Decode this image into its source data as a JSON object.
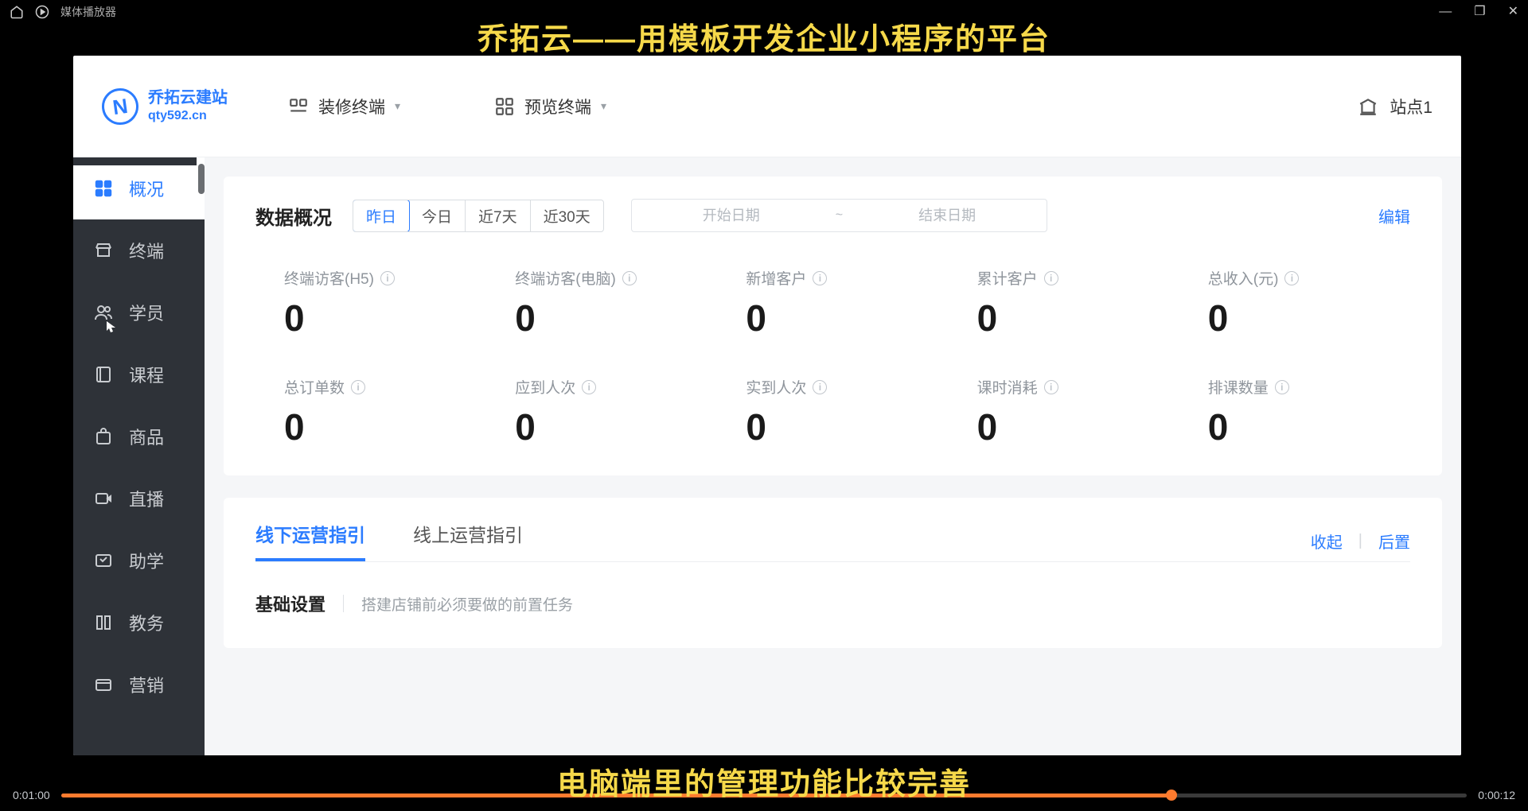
{
  "player": {
    "title": "媒体播放器",
    "current_time": "0:01:00",
    "total_time": "0:00:12",
    "progress_pct": 79
  },
  "captions": {
    "top": "乔拓云——用模板开发企业小程序的平台",
    "bottom": "电脑端里的管理功能比较完善"
  },
  "header": {
    "logo_line1": "乔拓云建站",
    "logo_line2": "qty592.cn",
    "decorate_label": "装修终端",
    "preview_label": "预览终端",
    "site_label": "站点1"
  },
  "sidebar": {
    "items": [
      {
        "label": "概况",
        "icon": "grid-icon",
        "active": true
      },
      {
        "label": "终端",
        "icon": "storefront-icon",
        "active": false
      },
      {
        "label": "学员",
        "icon": "users-icon",
        "active": false
      },
      {
        "label": "课程",
        "icon": "book-icon",
        "active": false
      },
      {
        "label": "商品",
        "icon": "bag-icon",
        "active": false
      },
      {
        "label": "直播",
        "icon": "video-icon",
        "active": false
      },
      {
        "label": "助学",
        "icon": "flag-icon",
        "active": false
      },
      {
        "label": "教务",
        "icon": "columns-icon",
        "active": false
      },
      {
        "label": "营销",
        "icon": "wallet-icon",
        "active": false
      }
    ]
  },
  "overview": {
    "title": "数据概况",
    "date_ranges": [
      "昨日",
      "今日",
      "近7天",
      "近30天"
    ],
    "active_range_index": 0,
    "date_start_placeholder": "开始日期",
    "date_end_placeholder": "结束日期",
    "edit_label": "编辑",
    "stats": [
      {
        "label": "终端访客(H5)",
        "value": "0"
      },
      {
        "label": "终端访客(电脑)",
        "value": "0"
      },
      {
        "label": "新增客户",
        "value": "0"
      },
      {
        "label": "累计客户",
        "value": "0"
      },
      {
        "label": "总收入(元)",
        "value": "0"
      },
      {
        "label": "总订单数",
        "value": "0"
      },
      {
        "label": "应到人次",
        "value": "0"
      },
      {
        "label": "实到人次",
        "value": "0"
      },
      {
        "label": "课时消耗",
        "value": "0"
      },
      {
        "label": "排课数量",
        "value": "0"
      }
    ]
  },
  "ops": {
    "tabs": [
      "线下运营指引",
      "线上运营指引"
    ],
    "active_tab_index": 0,
    "collapse_label": "收起",
    "postpone_label": "后置",
    "sub_title": "基础设置",
    "sub_desc": "搭建店铺前必须要做的前置任务"
  }
}
